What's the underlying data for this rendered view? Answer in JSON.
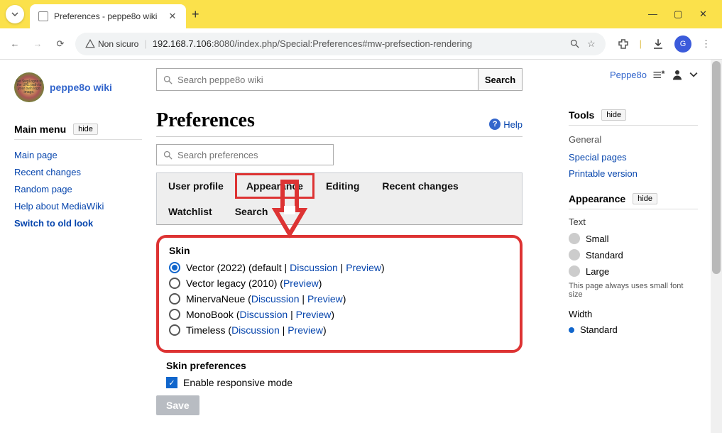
{
  "browser": {
    "tab_title": "Preferences - peppe8o wiki",
    "security_label": "Non sicuro",
    "url_host": "192.168.7.106",
    "url_port": ":8080",
    "url_path": "/index.php/Special:Preferences#mw-prefsection-rendering",
    "profile_initial": "G"
  },
  "wiki": {
    "name": "peppe8o wiki",
    "logo_text": "Set $wgLogos to the URL path to your own logo image.",
    "search_placeholder": "Search peppe8o wiki",
    "search_button": "Search"
  },
  "main_menu": {
    "title": "Main menu",
    "hide": "hide",
    "links": [
      "Main page",
      "Recent changes",
      "Random page",
      "Help about MediaWiki",
      "Switch to old look"
    ]
  },
  "page": {
    "title": "Preferences",
    "help": "Help",
    "pref_search_placeholder": "Search preferences"
  },
  "tabs": [
    "User profile",
    "Appearance",
    "Editing",
    "Recent changes",
    "Watchlist",
    "Search"
  ],
  "active_tab": "Appearance",
  "skin_section": {
    "heading": "Skin",
    "options": [
      {
        "name": "Vector (2022)",
        "extra": " (default | ",
        "link1": "Discussion",
        "sep": " | ",
        "link2": "Preview",
        "close": ")",
        "selected": true
      },
      {
        "name": "Vector legacy (2010)",
        "extra": " (",
        "link1": "Preview",
        "sep": "",
        "link2": "",
        "close": ")",
        "selected": false
      },
      {
        "name": "MinervaNeue",
        "extra": " (",
        "link1": "Discussion",
        "sep": " | ",
        "link2": "Preview",
        "close": ")",
        "selected": false
      },
      {
        "name": "MonoBook",
        "extra": " (",
        "link1": "Discussion",
        "sep": " | ",
        "link2": "Preview",
        "close": ")",
        "selected": false
      },
      {
        "name": "Timeless",
        "extra": " (",
        "link1": "Discussion",
        "sep": " | ",
        "link2": "Preview",
        "close": ")",
        "selected": false
      }
    ]
  },
  "skin_prefs": {
    "heading": "Skin preferences",
    "responsive": "Enable responsive mode"
  },
  "save": "Save",
  "user": "Peppe8o",
  "tools": {
    "title": "Tools",
    "hide": "hide",
    "general": "General",
    "links": [
      "Special pages",
      "Printable version"
    ]
  },
  "appearance_panel": {
    "title": "Appearance",
    "hide": "hide",
    "text_label": "Text",
    "sizes": [
      "Small",
      "Standard",
      "Large"
    ],
    "size_note": "This page always uses small font size",
    "width_label": "Width",
    "width_options": [
      "Standard"
    ]
  }
}
